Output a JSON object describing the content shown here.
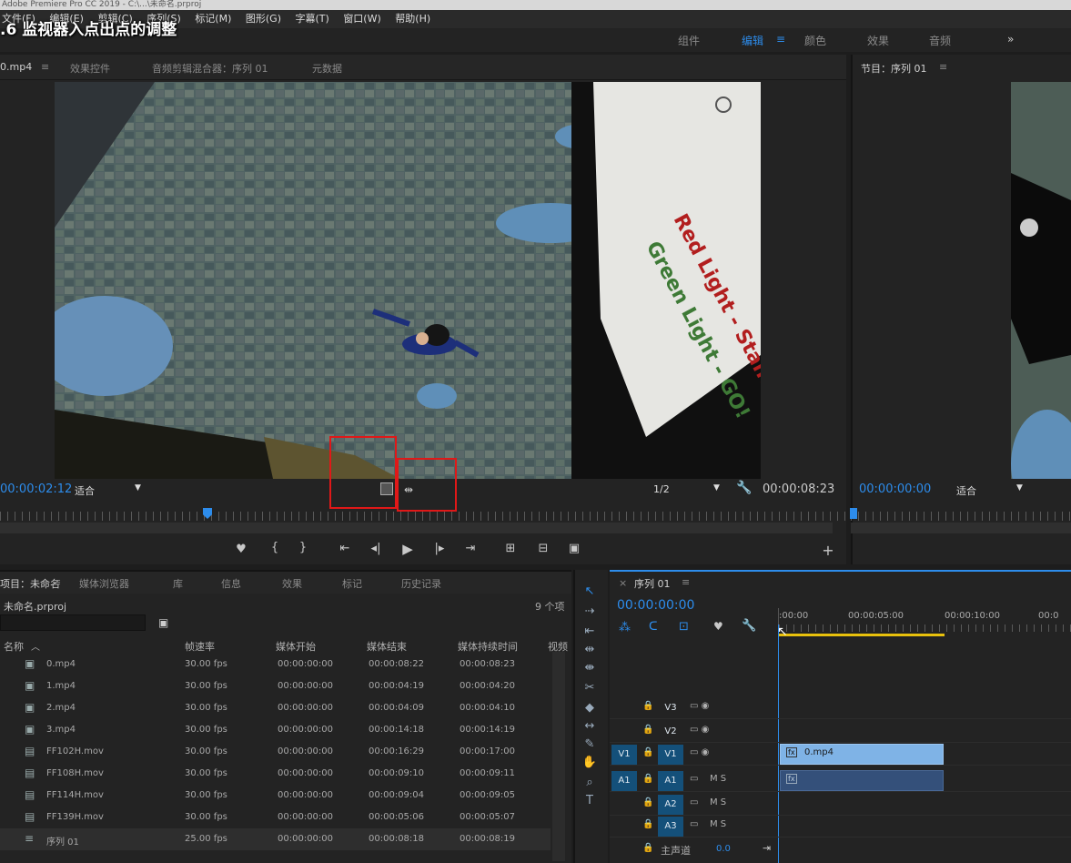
{
  "app": {
    "titlebar": "Adobe Premiere Pro CC 2019 - C:\\...\\未命名.prproj",
    "menu": [
      "文件(F)",
      "编辑(E)",
      "剪辑(C)",
      "序列(S)",
      "标记(M)",
      "图形(G)",
      "字幕(T)",
      "窗口(W)",
      "帮助(H)"
    ]
  },
  "overlay_title": ".6 监视器入点出点的调整",
  "workspaces": {
    "items": [
      "组件",
      "编辑",
      "颜色",
      "效果",
      "音频"
    ],
    "active": "编辑",
    "more": "»",
    "menu_icon": "≡"
  },
  "source_monitor": {
    "tabs": [
      "0.mp4",
      "效果控件",
      "音频剪辑混合器：序列 01",
      "元数据"
    ],
    "menu_icon": "≡",
    "timecode_in": "00:00:02:12",
    "fit": "适合",
    "resolution": "1/2",
    "timecode_out": "00:00:08:23",
    "video_text_1": "Red Light - Standby",
    "video_text_2": "Green Light - GO!",
    "controls": [
      "marker-icon",
      "{",
      "}",
      "go-in",
      "step-back",
      "play",
      "step-forward",
      "go-out",
      "insert",
      "overwrite",
      "export-frame"
    ],
    "plus": "+"
  },
  "program_monitor": {
    "title": "节目：序列 01",
    "menu_icon": "≡",
    "timecode": "00:00:00:00",
    "fit": "适合"
  },
  "project": {
    "tabs": [
      "项目：未命名",
      "媒体浏览器",
      "库",
      "信息",
      "效果",
      "标记",
      "历史记录"
    ],
    "filename": "未命名.prproj",
    "count": "9 个项",
    "columns": [
      "名称",
      "帧速率",
      "媒体开始",
      "媒体结束",
      "媒体持续时间",
      "视频"
    ],
    "rows": [
      {
        "icon": "video-clip-icon",
        "name": "0.mp4",
        "fps": "30.00 fps",
        "start": "00:00:00:00",
        "end": "00:00:08:22",
        "dur": "00:00:08:23"
      },
      {
        "icon": "video-clip-icon",
        "name": "1.mp4",
        "fps": "30.00 fps",
        "start": "00:00:00:00",
        "end": "00:00:04:19",
        "dur": "00:00:04:20"
      },
      {
        "icon": "video-clip-icon",
        "name": "2.mp4",
        "fps": "30.00 fps",
        "start": "00:00:00:00",
        "end": "00:00:04:09",
        "dur": "00:00:04:10"
      },
      {
        "icon": "video-clip-icon",
        "name": "3.mp4",
        "fps": "30.00 fps",
        "start": "00:00:00:00",
        "end": "00:00:14:18",
        "dur": "00:00:14:19"
      },
      {
        "icon": "film-icon",
        "name": "FF102H.mov",
        "fps": "30.00 fps",
        "start": "00:00:00:00",
        "end": "00:00:16:29",
        "dur": "00:00:17:00"
      },
      {
        "icon": "film-icon",
        "name": "FF108H.mov",
        "fps": "30.00 fps",
        "start": "00:00:00:00",
        "end": "00:00:09:10",
        "dur": "00:00:09:11"
      },
      {
        "icon": "film-icon",
        "name": "FF114H.mov",
        "fps": "30.00 fps",
        "start": "00:00:00:00",
        "end": "00:00:09:04",
        "dur": "00:00:09:05"
      },
      {
        "icon": "film-icon",
        "name": "FF139H.mov",
        "fps": "30.00 fps",
        "start": "00:00:00:00",
        "end": "00:00:05:06",
        "dur": "00:00:05:07"
      },
      {
        "icon": "sequence-icon",
        "name": "序列 01",
        "fps": "25.00 fps",
        "start": "00:00:00:00",
        "end": "00:00:08:18",
        "dur": "00:00:08:19"
      }
    ]
  },
  "timeline": {
    "title": "序列 01",
    "close": "×",
    "menu_icon": "≡",
    "timecode": "00:00:00:00",
    "ruler": [
      ":00:00",
      "00:00:05:00",
      "00:00:10:00",
      "00:0"
    ],
    "tracks": [
      {
        "src": "",
        "name": "V3",
        "extra": ""
      },
      {
        "src": "",
        "name": "V2",
        "extra": ""
      },
      {
        "src": "V1",
        "name": "V1",
        "extra": ""
      },
      {
        "src": "A1",
        "name": "A1",
        "extra": "M S"
      },
      {
        "src": "",
        "name": "A2",
        "extra": "M S"
      },
      {
        "src": "",
        "name": "A3",
        "extra": "M S"
      }
    ],
    "master": {
      "label": "主声道",
      "value": "0.0"
    },
    "clip_v": "0.mp4",
    "clip_fx": "fx"
  },
  "colors": {
    "accent": "#2d8ceb",
    "highlight": "#e01818",
    "clip_video": "#7fb3e6",
    "clip_audio": "#34507a",
    "inout_bar": "#e8c10c"
  }
}
